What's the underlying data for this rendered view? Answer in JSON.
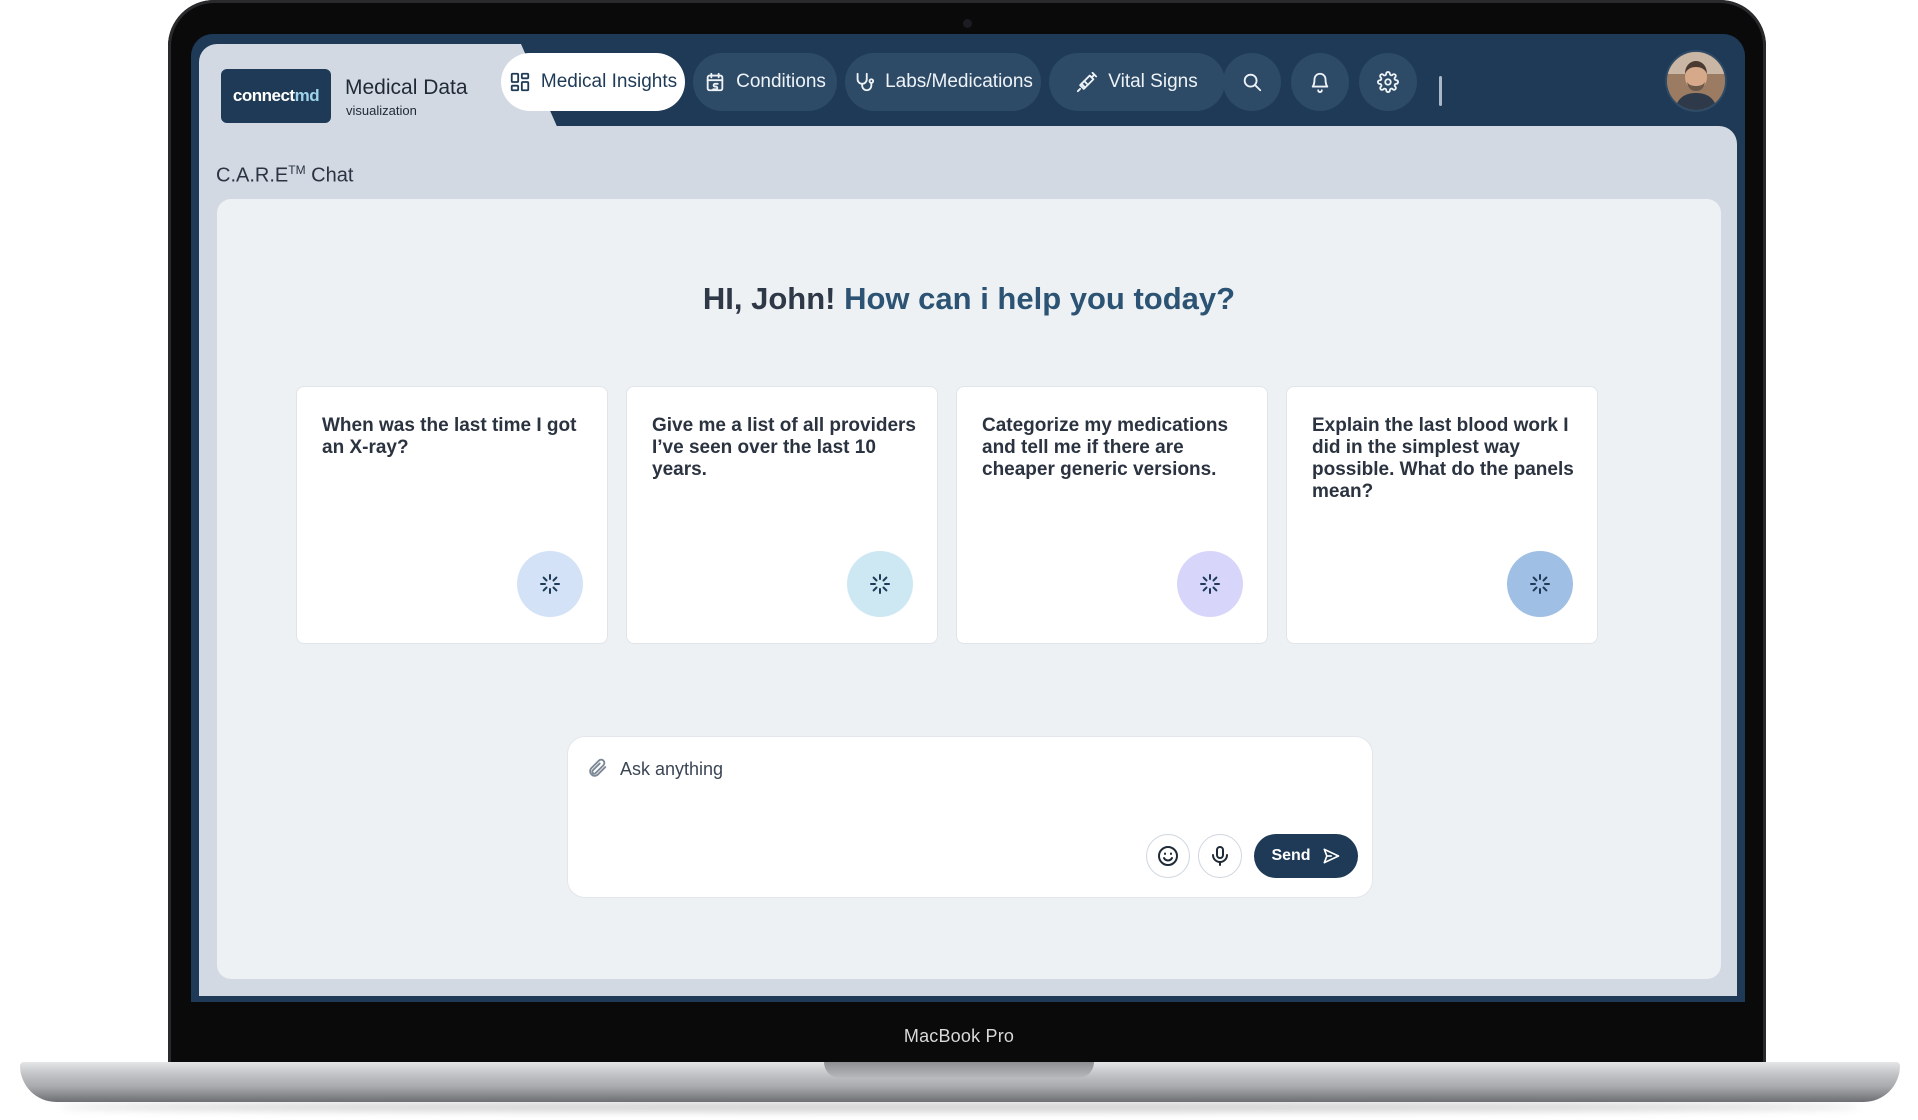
{
  "device": {
    "label": "MacBook Pro"
  },
  "brand": {
    "logo_text_main": "connect",
    "logo_text_accent": "md",
    "title": "Medical Data",
    "subtitle": "visualization"
  },
  "nav": {
    "items": [
      {
        "label": "Medical Insights",
        "icon": "dashboard-icon",
        "active": true
      },
      {
        "label": "Conditions",
        "icon": "calendar-icon",
        "active": false
      },
      {
        "label": "Labs/Medications",
        "icon": "stethoscope-icon",
        "active": false
      },
      {
        "label": "Vital Signs",
        "icon": "syringe-icon",
        "active": false
      }
    ],
    "actions": [
      "search-icon",
      "bell-icon",
      "gear-icon"
    ],
    "user_avatar": "user-avatar"
  },
  "section": {
    "title_main": "C.A.R.E",
    "title_sup": "TM",
    "title_tail": " Chat"
  },
  "greeting": {
    "hello": "HI, John! ",
    "question": "How can i help you today?"
  },
  "prompts": [
    {
      "text": "When was the last time I got an X-ray?",
      "color": "#d3e2f6"
    },
    {
      "text": "Give me a list of all providers I’ve seen over the last 10 years.",
      "color": "#cde8f3"
    },
    {
      "text": "Categorize my medications and tell me if there are cheaper generic versions.",
      "color": "#d8d5fb"
    },
    {
      "text": "Explain the last blood work I did in the simplest way possible. What do the panels mean?",
      "color": "#9fc0e4"
    }
  ],
  "composer": {
    "placeholder": "Ask anything",
    "value": "",
    "send_label": "Send"
  },
  "colors": {
    "brand_navy": "#1e3a56",
    "panel_bg": "#d3d9e2",
    "card_bg": "#edf1f4",
    "accent_text": "#2c5373"
  }
}
